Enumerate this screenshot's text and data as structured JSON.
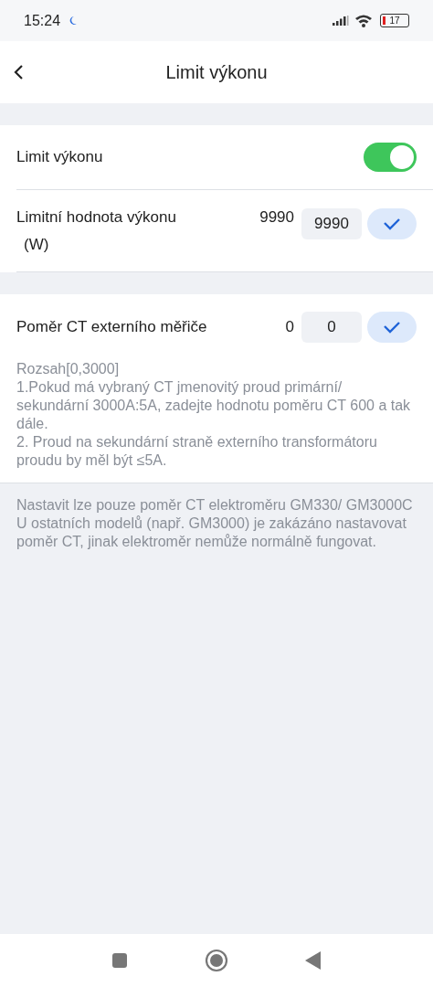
{
  "status_bar": {
    "time": "15:24",
    "battery": "17"
  },
  "header": {
    "title": "Limit výkonu"
  },
  "limit_card": {
    "toggle": {
      "label": "Limit výkonu",
      "on": true
    },
    "value_row": {
      "label": "Limitní hodnota výkonu",
      "unit": "(W)",
      "current": "9990",
      "input": "9990"
    }
  },
  "ct_card": {
    "label": "Poměr CT externího měřiče",
    "current": "0",
    "input": "0",
    "help": [
      "Rozsah[0,3000]",
      "1.Pokud má vybraný CT jmenovitý proud primární/ sekundární 3000A:5A, zadejte hodnotu poměru CT 600 a tak dále.",
      "2. Proud na sekundární straně externího transformátoru proudu by měl být ≤5A."
    ]
  },
  "note": "Nastavit lze pouze poměr CT elektroměru GM330/ GM3000C U ostatních modelů (např. GM3000) je zakázáno nastavovat poměr CT, jinak elektroměr nemůže normálně fungovat."
}
